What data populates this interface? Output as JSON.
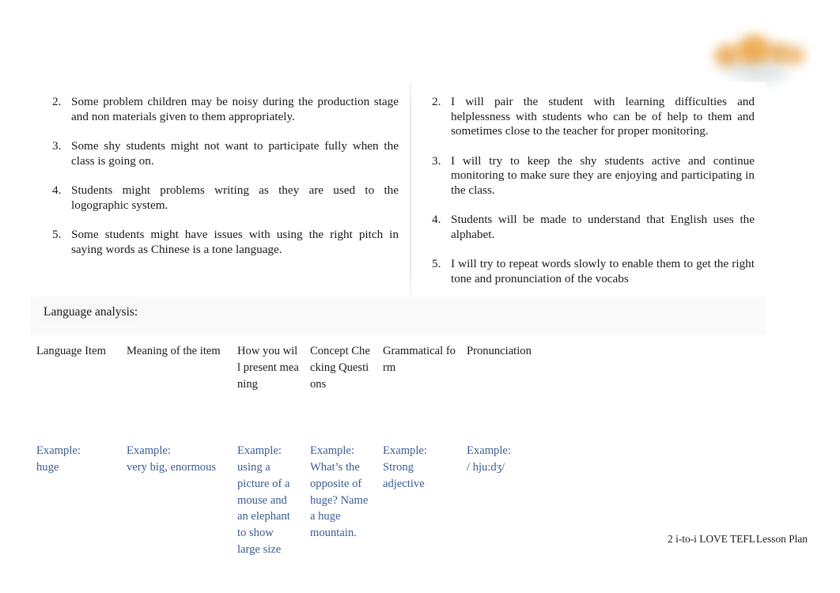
{
  "document": {
    "logo": {
      "name": "i-to-i-logo"
    },
    "columns": {
      "left": {
        "items": [
          {
            "number": "2.",
            "text": "Some problem children may be noisy during the production stage and non materials given to them appropriately."
          },
          {
            "number": "3.",
            "text": "Some shy students might not want to participate fully when the class is going on."
          },
          {
            "number": "4.",
            "text": "Students might problems writing as they are used to the logographic system."
          },
          {
            "number": "5.",
            "text": "Some students might have issues with using the right pitch in saying words as Chinese is a tone language."
          }
        ]
      },
      "right": {
        "items": [
          {
            "number": "2.",
            "text": "I will pair the student with learning difficulties and helplessness with students who can be of help to them and sometimes close to the teacher for proper monitoring."
          },
          {
            "number": "3.",
            "text": "I will try to keep the shy students active and continue monitoring to make sure they are enjoying and participating in the class."
          },
          {
            "number": "4.",
            "text": "Students will be made to understand that English uses the alphabet."
          },
          {
            "number": "5.",
            "text": "I will try to repeat words slowly to enable them to get the right tone and pronunciation   of the vocabs"
          }
        ]
      }
    },
    "language_analysis": {
      "heading": "Language analysis:",
      "table": {
        "headers": [
          "Language Item",
          "Meaning of the item",
          "How you will present meaning",
          "Concept Checking Questions",
          "Grammatical form",
          "Pronunciation"
        ],
        "rows": [
          {
            "label": "Example:",
            "cells": [
              "huge",
              "very big, enormous",
              "using a picture of a mouse and an elephant to show large size",
              "What’s the opposite of huge? Name a huge mountain.",
              "Strong adjective",
              "/ hju:dʒ/"
            ]
          }
        ]
      }
    },
    "footer": {
      "left_text": "2 i-to-i LOVE TEFL",
      "right_text": "Lesson Plan"
    },
    "colors": {
      "example_text": "#3a5a96",
      "body_text": "#1a1a1a",
      "logo_orange": "#e8a24a",
      "page_background": "#ffffff"
    }
  }
}
